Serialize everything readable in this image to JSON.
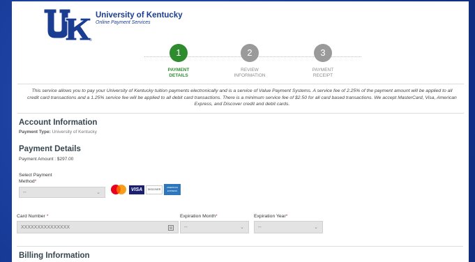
{
  "header": {
    "title": "University of Kentucky",
    "subtitle": "Online Payment Services",
    "logo_text": "UK"
  },
  "steps": [
    {
      "number": "1",
      "label_line1": "PAYMENT",
      "label_line2": "DETAILS",
      "active": true
    },
    {
      "number": "2",
      "label_line1": "REVIEW",
      "label_line2": "INFORMATION",
      "active": false
    },
    {
      "number": "3",
      "label_line1": "PAYMENT",
      "label_line2": "RECEIPT",
      "active": false
    }
  ],
  "colors": {
    "active_step": "#2e8b2e",
    "inactive_step": "#9a9a9a",
    "brand": "#1a3c91"
  },
  "intro_text": "This service allows you to pay your University of Kentucky tuition payments electronically and is a service of Value Payment Systems. A service fee of 2.25% of the payment amount will be applied to all credit card transactions and a 1.25% service fee will be applied to all debit card transactions. There is a minimum service fee of $2.50 for all card based transactions. We accept MasterCard, Visa, American Express, and Discover credit and debit cards.",
  "account": {
    "heading": "Account Information",
    "payment_type_label": "Payment Type:",
    "payment_type_value": "University of Kentucky"
  },
  "payment": {
    "heading": "Payment Details",
    "amount_text": "Payment Amount : $297.00",
    "method_label_line1": "Select Payment",
    "method_label_line2": "Method",
    "method_value": "--",
    "cards": {
      "visa": "VISA",
      "discover": "DISCOVER",
      "amex": "AMERICAN EXPRESS"
    }
  },
  "card_fields": {
    "card_number_label": "Card Number",
    "card_number_placeholder": "XXXXXXXXXXXXXXX",
    "exp_month_label": "Expiration Month",
    "exp_month_value": "--",
    "exp_year_label": "Expiration Year",
    "exp_year_value": "--",
    "required_mark": "*"
  },
  "billing": {
    "heading": "Billing Information"
  }
}
